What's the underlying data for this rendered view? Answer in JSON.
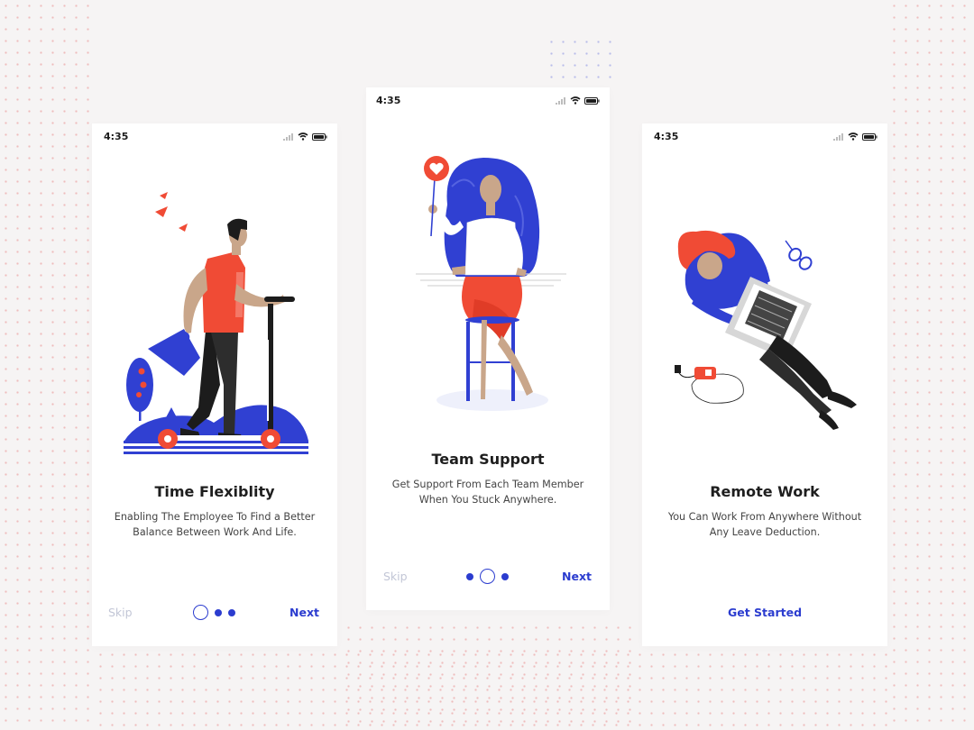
{
  "colors": {
    "accent_blue": "#2b3ccf",
    "accent_red": "#f04b35",
    "muted": "#c2c6d6",
    "background": "#f6f4f4"
  },
  "screens": [
    {
      "status": {
        "time": "4:35"
      },
      "illustration": "man-riding-scooter-illustration",
      "title": "Time Flexiblity",
      "description": [
        "Enabling The Employee To Find a Better",
        "Balance Between Work And Life."
      ],
      "skip_label": "Skip",
      "next_label": "Next",
      "pager": {
        "pages": 3,
        "active": 1
      }
    },
    {
      "status": {
        "time": "4:35"
      },
      "illustration": "woman-holding-heart-sign-illustration",
      "title": "Team Support",
      "description": [
        "Get Support From Each Team Member",
        "When You Stuck Anywhere."
      ],
      "skip_label": "Skip",
      "next_label": "Next",
      "pager": {
        "pages": 3,
        "active": 2
      }
    },
    {
      "status": {
        "time": "4:35"
      },
      "illustration": "woman-working-on-laptop-illustration",
      "title": "Remote Work",
      "description": [
        "You Can Work From Anywhere Without",
        "Any Leave Deduction."
      ],
      "cta_label": "Get Started"
    }
  ]
}
